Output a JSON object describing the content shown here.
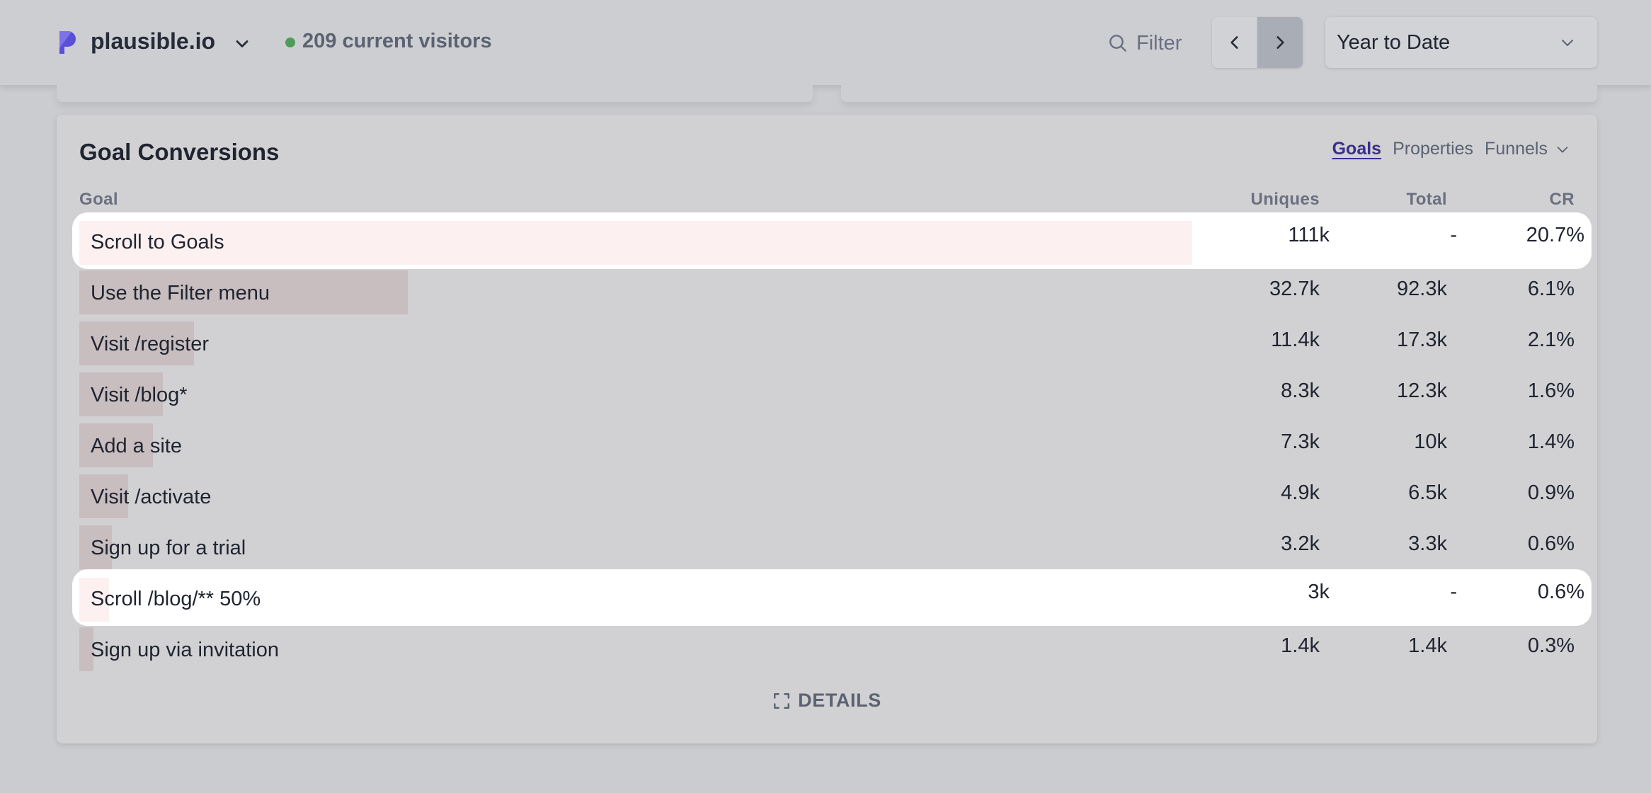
{
  "header": {
    "site_name": "plausible.io",
    "live_visitors": "209 current visitors",
    "filter_label": "Filter",
    "period_label": "Year to Date"
  },
  "colors": {
    "brand": "#5b4fd6",
    "live_dot": "#4f9c5a",
    "active_tab": "#3a2f8c",
    "bar": "#c8bdbf",
    "bar_highlight": "#fcf0f0"
  },
  "icons": {
    "logo": "plausible-logo-icon",
    "site_dropdown": "chevron-down-icon",
    "filter": "search-icon",
    "prev": "chevron-left-icon",
    "next": "chevron-right-icon",
    "period_dropdown": "chevron-down-icon",
    "funnels_dropdown": "chevron-down-icon",
    "details": "expand-icon"
  },
  "card": {
    "title": "Goal Conversions",
    "tabs": [
      {
        "label": "Goals",
        "active": true
      },
      {
        "label": "Properties",
        "active": false
      },
      {
        "label": "Funnels",
        "active": false
      }
    ],
    "columns": {
      "goal": "Goal",
      "uniques": "Uniques",
      "total": "Total",
      "cr": "CR"
    },
    "rows": [
      {
        "goal": "Scroll to Goals",
        "uniques": "111k",
        "total": "-",
        "cr": "20.7%",
        "share": 1.0,
        "highlighted": true
      },
      {
        "goal": "Use the Filter menu",
        "uniques": "32.7k",
        "total": "92.3k",
        "cr": "6.1%",
        "share": 0.295,
        "highlighted": false
      },
      {
        "goal": "Visit /register",
        "uniques": "11.4k",
        "total": "17.3k",
        "cr": "2.1%",
        "share": 0.103,
        "highlighted": false
      },
      {
        "goal": "Visit /blog*",
        "uniques": "8.3k",
        "total": "12.3k",
        "cr": "1.6%",
        "share": 0.075,
        "highlighted": false
      },
      {
        "goal": "Add a site",
        "uniques": "7.3k",
        "total": "10k",
        "cr": "1.4%",
        "share": 0.066,
        "highlighted": false
      },
      {
        "goal": "Visit /activate",
        "uniques": "4.9k",
        "total": "6.5k",
        "cr": "0.9%",
        "share": 0.044,
        "highlighted": false
      },
      {
        "goal": "Sign up for a trial",
        "uniques": "3.2k",
        "total": "3.3k",
        "cr": "0.6%",
        "share": 0.029,
        "highlighted": false
      },
      {
        "goal": "Scroll /blog/** 50%",
        "uniques": "3k",
        "total": "-",
        "cr": "0.6%",
        "share": 0.027,
        "highlighted": true
      },
      {
        "goal": "Sign up via invitation",
        "uniques": "1.4k",
        "total": "1.4k",
        "cr": "0.3%",
        "share": 0.013,
        "highlighted": false
      }
    ],
    "details_label": "DETAILS"
  }
}
